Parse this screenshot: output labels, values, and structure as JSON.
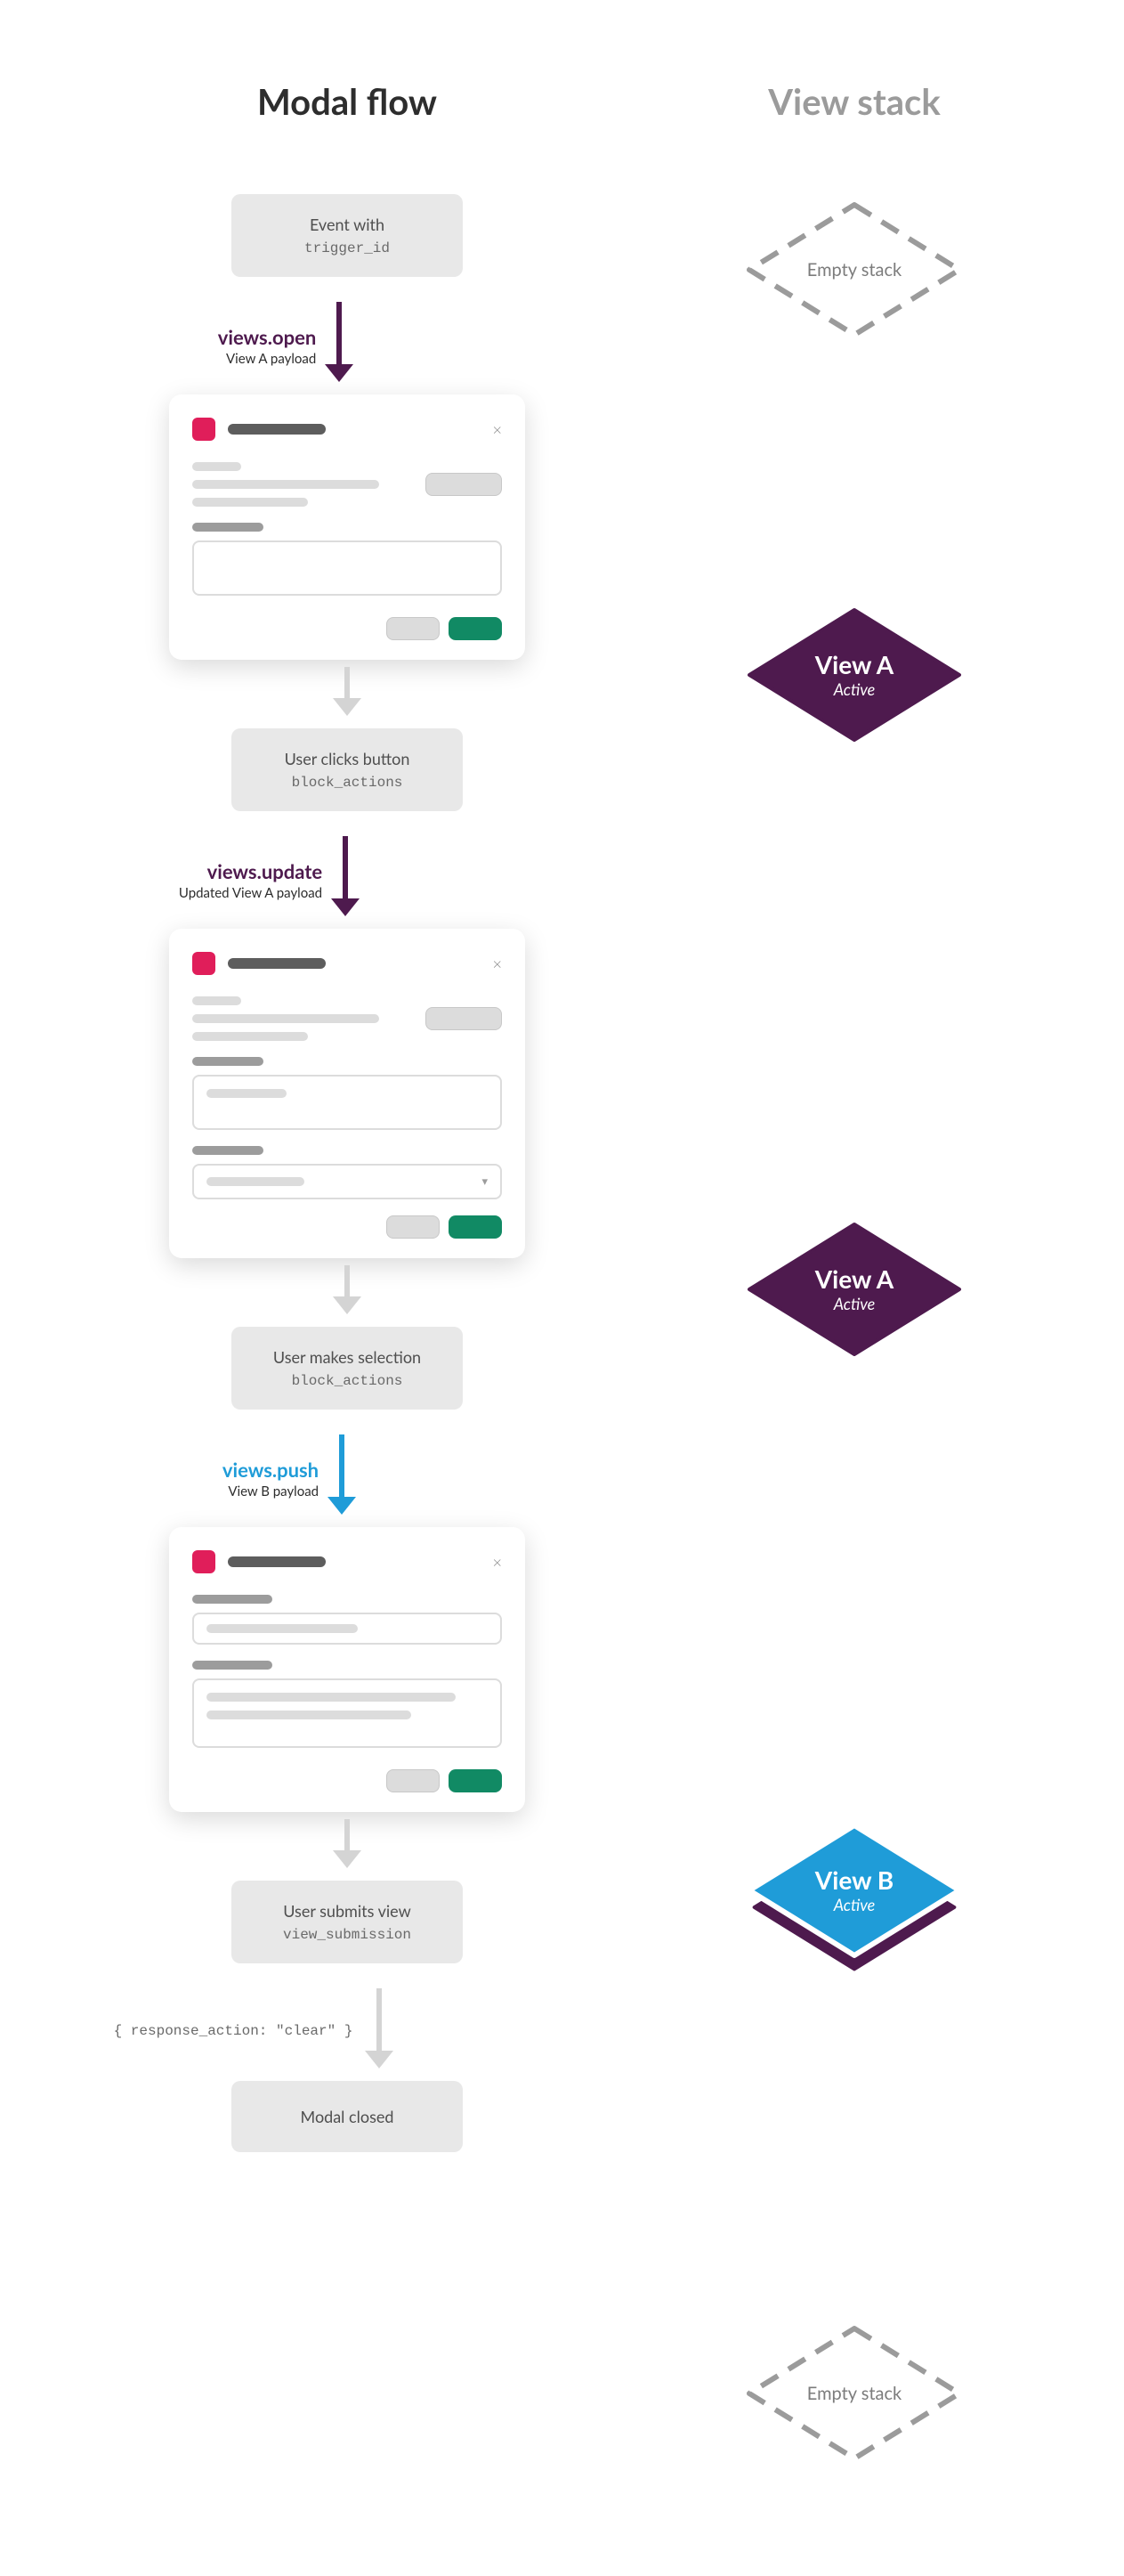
{
  "headings": {
    "flow": "Modal flow",
    "stack": "View stack"
  },
  "events": {
    "initial": {
      "title": "Event with",
      "code": "trigger_id"
    },
    "click": {
      "title": "User clicks button",
      "code": "block_actions"
    },
    "select": {
      "title": "User makes selection",
      "code": "block_actions"
    },
    "submit": {
      "title": "User submits view",
      "code": "view_submission"
    },
    "closed": {
      "title": "Modal closed"
    }
  },
  "api": {
    "open": {
      "name": "views.open",
      "sub": "View A payload"
    },
    "update": {
      "name": "views.update",
      "sub": "Updated View A payload"
    },
    "push": {
      "name": "views.push",
      "sub": "View B payload"
    }
  },
  "response_action_snippet": "{ response_action: \"clear\" }",
  "stack": {
    "empty": "Empty stack",
    "view_a": {
      "name": "View A",
      "state": "Active"
    },
    "view_b": {
      "name": "View B",
      "state": "Active"
    }
  },
  "colors": {
    "purple": "#4e1a4e",
    "blue": "#1f9cd8",
    "slack_pink": "#e01e5a",
    "green": "#118a64",
    "grey_dashed": "#9b9b9b"
  }
}
